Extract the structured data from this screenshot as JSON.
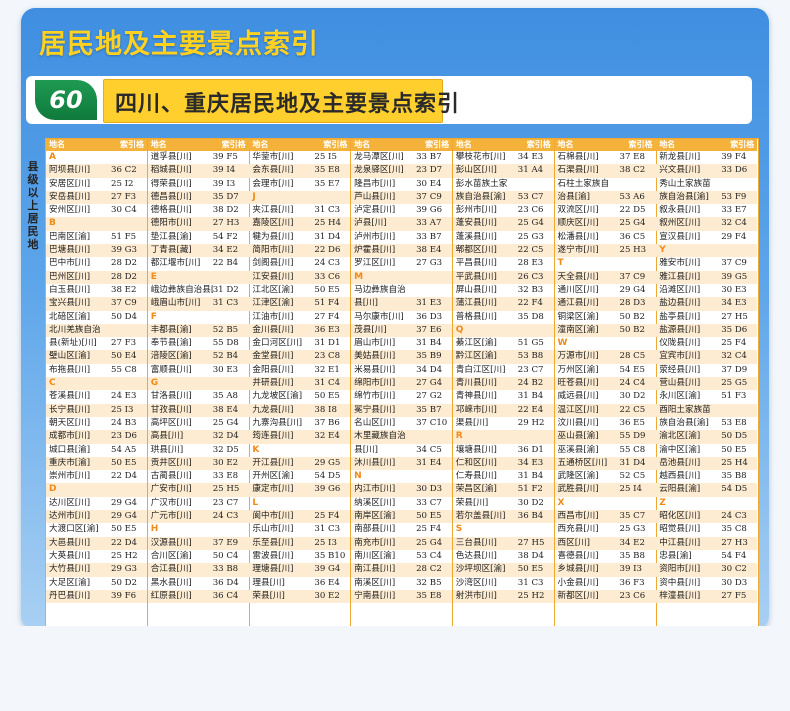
{
  "header": {
    "title": "居民地及主要景点索引",
    "page_number": "60",
    "subtitle": "四川、重庆居民地及主要景点索引"
  },
  "side_label": "县级以上居民地",
  "columns": [
    {
      "head_name": "地名",
      "head_index": "索引格",
      "rows": [
        [
          "A",
          ""
        ],
        [
          "阿坝县[川]",
          "36 C2"
        ],
        [
          "安居区[川]",
          "25 I2"
        ],
        [
          "安岳县[川]",
          "27 F3"
        ],
        [
          "安州区[川]",
          "30 C4"
        ],
        [
          "B",
          ""
        ],
        [
          "巴南区[渝]",
          "51 F5"
        ],
        [
          "巴塘县[川]",
          "39 G3"
        ],
        [
          "巴中市[川]",
          "28 D2"
        ],
        [
          "巴州区[川]",
          "28 D2"
        ],
        [
          "白玉县[川]",
          "38 E2"
        ],
        [
          "宝兴县[川]",
          "37 C9"
        ],
        [
          "北碚区[渝]",
          "50 D4"
        ],
        [
          "北川羌族自治",
          ""
        ],
        [
          "县(新址)[川]",
          "27 F3"
        ],
        [
          "璧山区[渝]",
          "50 E4"
        ],
        [
          "布拖县[川]",
          "55 C8"
        ],
        [
          "C",
          ""
        ],
        [
          "苍溪县[川]",
          "24 E3"
        ],
        [
          "长宁县[川]",
          "25 I3"
        ],
        [
          "朝天区[川]",
          "24 B3"
        ],
        [
          "成都市[川]",
          "23 D6"
        ],
        [
          "城口县[渝]",
          "54 A5"
        ],
        [
          "重庆市[渝]",
          "50 E5"
        ],
        [
          "崇州市[川]",
          "22 D4"
        ],
        [
          "D",
          ""
        ],
        [
          "达川区[川]",
          "29 G4"
        ],
        [
          "达州市[川]",
          "29 G4"
        ],
        [
          "大渡口区[渝]",
          "50 E5"
        ],
        [
          "大邑县[川]",
          "22 D4"
        ],
        [
          "大英县[川]",
          "25 H2"
        ],
        [
          "大竹县[川]",
          "29 G3"
        ],
        [
          "大足区[渝]",
          "50 D2"
        ],
        [
          "丹巴县[川]",
          "39 F6"
        ]
      ]
    },
    {
      "head_name": "地名",
      "head_index": "索引格",
      "rows": [
        [
          "道孚县[川]",
          "39 F5"
        ],
        [
          "稻城县[川]",
          "39 I4"
        ],
        [
          "得荣县[川]",
          "39 I3"
        ],
        [
          "德昌县[川]",
          "35 D7"
        ],
        [
          "德格县[川]",
          "38 D2"
        ],
        [
          "德阳市[川]",
          "27 H3"
        ],
        [
          "垫江县[渝]",
          "54 F2"
        ],
        [
          "丁青县[藏]",
          "34 E2"
        ],
        [
          "都江堰市[川]",
          "22 B4"
        ],
        [
          "E",
          ""
        ],
        [
          "峨边彝族自治县[川]",
          "31 D2"
        ],
        [
          "峨眉山市[川]",
          "31 C3"
        ],
        [
          "F",
          ""
        ],
        [
          "丰都县[渝]",
          "52 B5"
        ],
        [
          "奉节县[渝]",
          "55 D8"
        ],
        [
          "涪陵区[渝]",
          "52 B4"
        ],
        [
          "富顺县[川]",
          "30 E3"
        ],
        [
          "G",
          ""
        ],
        [
          "甘洛县[川]",
          "35 A8"
        ],
        [
          "甘孜县[川]",
          "38 E4"
        ],
        [
          "高坪区[川]",
          "25 G4"
        ],
        [
          "高县[川]",
          "32 D4"
        ],
        [
          "珙县[川]",
          "32 D5"
        ],
        [
          "贡井区[川]",
          "30 E2"
        ],
        [
          "古蔺县[川]",
          "33 E8"
        ],
        [
          "广安市[川]",
          "25 H5"
        ],
        [
          "广汉市[川]",
          "23 C7"
        ],
        [
          "广元市[川]",
          "24 C3"
        ],
        [
          "H",
          ""
        ],
        [
          "汉源县[川]",
          "37 E9"
        ],
        [
          "合川区[渝]",
          "50 C4"
        ],
        [
          "合江县[川]",
          "33 B8"
        ],
        [
          "黑水县[川]",
          "36 D4"
        ],
        [
          "红原县[川]",
          "36 C4"
        ]
      ]
    },
    {
      "head_name": "地名",
      "head_index": "索引格",
      "rows": [
        [
          "华蓥市[川]",
          "25 I5"
        ],
        [
          "会东县[川]",
          "35 E8"
        ],
        [
          "会理市[川]",
          "35 E7"
        ],
        [
          "J",
          ""
        ],
        [
          "夹江县[川]",
          "31 C3"
        ],
        [
          "嘉陵区[川]",
          "25 H4"
        ],
        [
          "犍为县[川]",
          "31 D4"
        ],
        [
          "简阳市[川]",
          "22 D6"
        ],
        [
          "剑阁县[川]",
          "24 C3"
        ],
        [
          "江安县[川]",
          "33 C6"
        ],
        [
          "江北区[渝]",
          "50 E5"
        ],
        [
          "江津区[渝]",
          "51 F4"
        ],
        [
          "江油市[川]",
          "27 F4"
        ],
        [
          "金川县[川]",
          "36 E3"
        ],
        [
          "金口河区[川]",
          "31 D1"
        ],
        [
          "金堂县[川]",
          "23 C8"
        ],
        [
          "金阳县[川]",
          "32 E1"
        ],
        [
          "井研县[川]",
          "31 C4"
        ],
        [
          "九龙坡区[渝]",
          "50 E5"
        ],
        [
          "九龙县[川]",
          "38 I8"
        ],
        [
          "九寨沟县[川]",
          "37 B6"
        ],
        [
          "筠连县[川]",
          "32 E4"
        ],
        [
          "K",
          ""
        ],
        [
          "开江县[川]",
          "29 G5"
        ],
        [
          "开州区[渝]",
          "54 D5"
        ],
        [
          "康定市[川]",
          "39 G6"
        ],
        [
          "L",
          ""
        ],
        [
          "阆中市[川]",
          "25 F4"
        ],
        [
          "乐山市[川]",
          "31 C3"
        ],
        [
          "乐至县[川]",
          "25 I3"
        ],
        [
          "雷波县[川]",
          "35 B10"
        ],
        [
          "理塘县[川]",
          "39 G4"
        ],
        [
          "理县[川]",
          "36 E4"
        ],
        [
          "荣县[川]",
          "30 E2"
        ]
      ]
    },
    {
      "head_name": "地名",
      "head_index": "索引格",
      "rows": [
        [
          "龙马潭区[川]",
          "33 B7"
        ],
        [
          "龙泉驿区[川]",
          "23 D7"
        ],
        [
          "隆昌市[川]",
          "30 E4"
        ],
        [
          "芦山县[川]",
          "37 C9"
        ],
        [
          "泸定县[川]",
          "39 G6"
        ],
        [
          "泸县[川]",
          "33 A7"
        ],
        [
          "泸州市[川]",
          "33 B7"
        ],
        [
          "炉霍县[川]",
          "38 E4"
        ],
        [
          "罗江区[川]",
          "27 G3"
        ],
        [
          "M",
          ""
        ],
        [
          "马边彝族自治",
          ""
        ],
        [
          "县[川]",
          "31 E3"
        ],
        [
          "马尔康市[川]",
          "36 D3"
        ],
        [
          "茂县[川]",
          "37 E6"
        ],
        [
          "眉山市[川]",
          "31 B4"
        ],
        [
          "美姑县[川]",
          "35 B9"
        ],
        [
          "米易县[川]",
          "34 D4"
        ],
        [
          "绵阳市[川]",
          "27 G4"
        ],
        [
          "绵竹市[川]",
          "27 G2"
        ],
        [
          "冕宁县[川]",
          "35 B7"
        ],
        [
          "名山区[川]",
          "37 C10"
        ],
        [
          "木里藏族自治",
          ""
        ],
        [
          "县[川]",
          "34 C5"
        ],
        [
          "沐川县[川]",
          "31 E4"
        ],
        [
          "N",
          ""
        ],
        [
          "内江市[川]",
          "30 D3"
        ],
        [
          "纳溪区[川]",
          "33 C7"
        ],
        [
          "南岸区[渝]",
          "50 E5"
        ],
        [
          "南部县[川]",
          "25 F4"
        ],
        [
          "南充市[川]",
          "25 G4"
        ],
        [
          "南川区[渝]",
          "53 C4"
        ],
        [
          "南江县[川]",
          "28 C2"
        ],
        [
          "南溪区[川]",
          "32 B5"
        ],
        [
          "宁南县[川]",
          "35 E8"
        ]
      ]
    },
    {
      "head_name": "地名",
      "head_index": "索引格",
      "rows": [
        [
          "攀枝花市[川]",
          "34 E3"
        ],
        [
          "彭山区[川]",
          "31 A4"
        ],
        [
          "彭水苗族土家",
          ""
        ],
        [
          "族自治县[渝]",
          "53 C7"
        ],
        [
          "彭州市[川]",
          "23 C6"
        ],
        [
          "蓬安县[川]",
          "25 G4"
        ],
        [
          "蓬溪县[川]",
          "25 G3"
        ],
        [
          "郫都区[川]",
          "22 C5"
        ],
        [
          "平昌县[川]",
          "28 E3"
        ],
        [
          "平武县[川]",
          "26 C3"
        ],
        [
          "屏山县[川]",
          "32 B3"
        ],
        [
          "蒲江县[川]",
          "22 F4"
        ],
        [
          "普格县[川]",
          "35 D8"
        ],
        [
          "Q",
          ""
        ],
        [
          "綦江区[渝]",
          "51 G5"
        ],
        [
          "黔江区[渝]",
          "53 B8"
        ],
        [
          "青白江区[川]",
          "23 C7"
        ],
        [
          "青川县[川]",
          "24 B2"
        ],
        [
          "青神县[川]",
          "31 B4"
        ],
        [
          "邛崃市[川]",
          "22 E4"
        ],
        [
          "渠县[川]",
          "29 H2"
        ],
        [
          "R",
          ""
        ],
        [
          "壤塘县[川]",
          "36 D1"
        ],
        [
          "仁和区[川]",
          "34 E3"
        ],
        [
          "仁寿县[川]",
          "31 B4"
        ],
        [
          "荣昌区[渝]",
          "51 F2"
        ],
        [
          "荣县[川]",
          "30 D2"
        ],
        [
          "若尔盖县[川]",
          "36 B4"
        ],
        [
          "S",
          ""
        ],
        [
          "三台县[川]",
          "27 H5"
        ],
        [
          "色达县[川]",
          "38 D4"
        ],
        [
          "沙坪坝区[渝]",
          "50 E5"
        ],
        [
          "沙湾区[川]",
          "31 C3"
        ],
        [
          "射洪市[川]",
          "25 H2"
        ]
      ]
    },
    {
      "head_name": "地名",
      "head_index": "索引格",
      "rows": [
        [
          "石棉县[川]",
          "37 E8"
        ],
        [
          "石渠县[川]",
          "38 C2"
        ],
        [
          "石柱土家族自",
          ""
        ],
        [
          "治县[渝]",
          "53 A6"
        ],
        [
          "双流区[川]",
          "22 D5"
        ],
        [
          "顺庆区[川]",
          "25 G4"
        ],
        [
          "松潘县[川]",
          "36 C5"
        ],
        [
          "遂宁市[川]",
          "25 H3"
        ],
        [
          "T",
          ""
        ],
        [
          "天全县[川]",
          "37 C9"
        ],
        [
          "通川区[川]",
          "29 G4"
        ],
        [
          "通江县[川]",
          "28 D3"
        ],
        [
          "铜梁区[渝]",
          "50 B2"
        ],
        [
          "潼南区[渝]",
          "50 B2"
        ],
        [
          "W",
          ""
        ],
        [
          "万源市[川]",
          "28 C5"
        ],
        [
          "万州区[渝]",
          "54 E5"
        ],
        [
          "旺苍县[川]",
          "24 C4"
        ],
        [
          "威远县[川]",
          "30 D2"
        ],
        [
          "温江区[川]",
          "22 C5"
        ],
        [
          "汶川县[川]",
          "36 E5"
        ],
        [
          "巫山县[渝]",
          "55 D9"
        ],
        [
          "巫溪县[渝]",
          "55 C8"
        ],
        [
          "五通桥区[川]",
          "31 D4"
        ],
        [
          "武隆区[渝]",
          "52 C5"
        ],
        [
          "武胜县[川]",
          "25 I4"
        ],
        [
          "X",
          ""
        ],
        [
          "西昌市[川]",
          "35 C7"
        ],
        [
          "西充县[川]",
          "25 G3"
        ],
        [
          "西区[川]",
          "34 E2"
        ],
        [
          "喜德县[川]",
          "35 B8"
        ],
        [
          "乡城县[川]",
          "39 I3"
        ],
        [
          "小金县[川]",
          "36 F3"
        ],
        [
          "新都区[川]",
          "23 C6"
        ]
      ]
    },
    {
      "head_name": "地名",
      "head_index": "索引格",
      "rows": [
        [
          "新龙县[川]",
          "39 F4"
        ],
        [
          "兴文县[川]",
          "33 D6"
        ],
        [
          "秀山土家族苗",
          ""
        ],
        [
          "族自治县[渝]",
          "53 F9"
        ],
        [
          "叙永县[川]",
          "33 E7"
        ],
        [
          "叙州区[川]",
          "32 C4"
        ],
        [
          "宣汉县[川]",
          "29 F4"
        ],
        [
          "Y",
          ""
        ],
        [
          "雅安市[川]",
          "37 C9"
        ],
        [
          "雅江县[川]",
          "39 G5"
        ],
        [
          "沿滩区[川]",
          "30 E3"
        ],
        [
          "盐边县[川]",
          "34 E3"
        ],
        [
          "盐亭县[川]",
          "27 H5"
        ],
        [
          "盐源县[川]",
          "35 D6"
        ],
        [
          "仪陇县[川]",
          "25 F4"
        ],
        [
          "宜宾市[川]",
          "32 C4"
        ],
        [
          "荥经县[川]",
          "37 D9"
        ],
        [
          "营山县[川]",
          "25 G5"
        ],
        [
          "永川区[渝]",
          "51 F3"
        ],
        [
          "酉阳土家族苗",
          ""
        ],
        [
          "族自治县[渝]",
          "53 E8"
        ],
        [
          "渝北区[渝]",
          "50 D5"
        ],
        [
          "渝中区[渝]",
          "50 E5"
        ],
        [
          "岳池县[川]",
          "25 H4"
        ],
        [
          "越西县[川]",
          "35 B8"
        ],
        [
          "云阳县[渝]",
          "54 D5"
        ],
        [
          "Z",
          ""
        ],
        [
          "昭化区[川]",
          "24 C3"
        ],
        [
          "昭觉县[川]",
          "35 C8"
        ],
        [
          "中江县[川]",
          "27 H3"
        ],
        [
          "忠县[渝]",
          "54 F4"
        ],
        [
          "资阳市[川]",
          "30 C2"
        ],
        [
          "资中县[川]",
          "30 D3"
        ],
        [
          "梓潼县[川]",
          "27 F5"
        ]
      ]
    }
  ]
}
